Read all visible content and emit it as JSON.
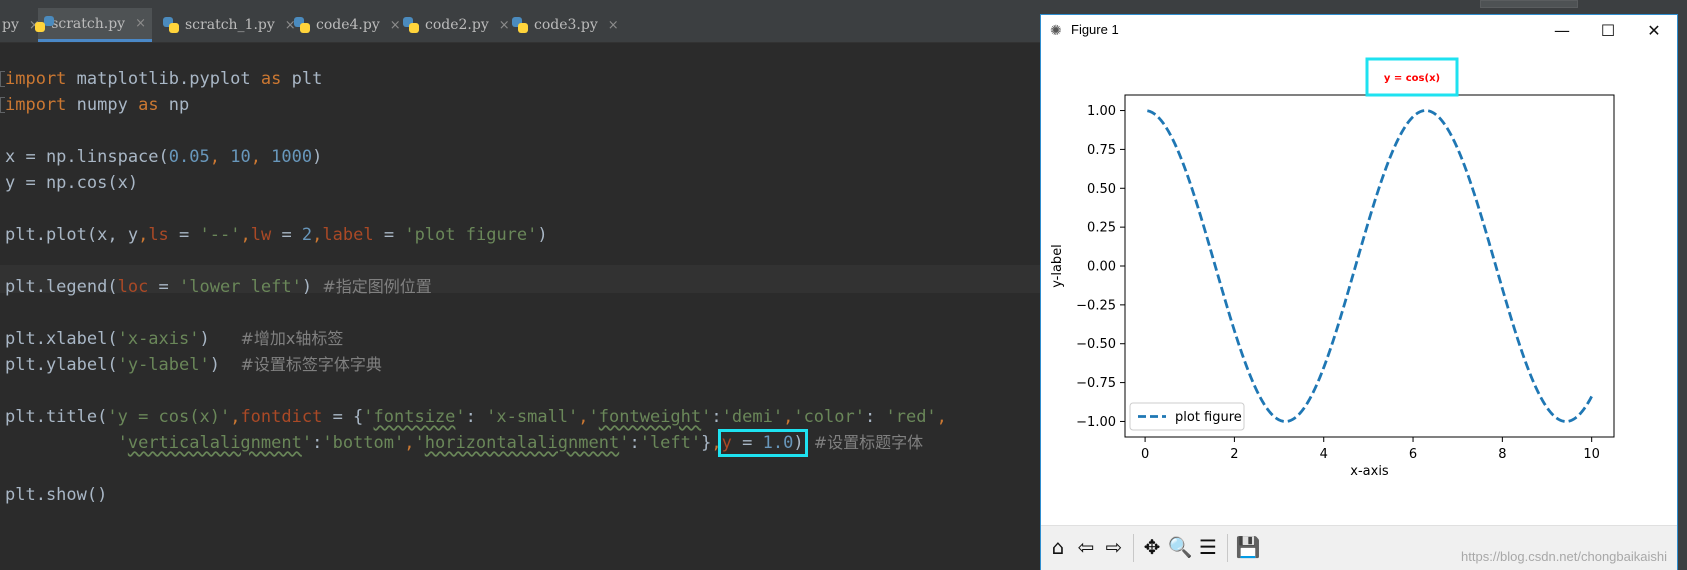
{
  "ide": {
    "tabs": [
      {
        "label": "py",
        "active": false
      },
      {
        "label": "scratch.py",
        "active": true
      },
      {
        "label": "scratch_1.py",
        "active": false
      },
      {
        "label": "code4.py",
        "active": false
      },
      {
        "label": "code2.py",
        "active": false
      },
      {
        "label": "code3.py",
        "active": false
      }
    ],
    "close_glyph": "×",
    "code": {
      "l1": {
        "kw1": "import",
        "mod": " matplotlib.pyplot ",
        "kw2": "as",
        "alias": " plt"
      },
      "l2": {
        "kw1": "import",
        "mod": " numpy ",
        "kw2": "as",
        "alias": " np"
      },
      "l3": {
        "a": "x = np.linspace(",
        "n1": "0.05",
        "c1": ", ",
        "n2": "10",
        "c2": ", ",
        "n3": "1000",
        "b": ")"
      },
      "l4": {
        "a": "y = np.cos(x)"
      },
      "l5": {
        "a": "plt.plot(x, y",
        "c1": ",",
        "p1": "ls",
        "e1": " = ",
        "s1": "'--'",
        "c2": ",",
        "p2": "lw",
        "e2": " = ",
        "n1": "2",
        "c3": ",",
        "p3": "label",
        "e3": " = ",
        "s2": "'plot figure'",
        "b": ")"
      },
      "l6": {
        "a": "plt.legend(",
        "p1": "loc",
        "e1": " = ",
        "s1": "'lower left'",
        "b": ") ",
        "cmt": "#指定图例位置"
      },
      "l7": {
        "a": "plt.xlabel(",
        "s1": "'x-axis'",
        "b": ")   ",
        "cmt": "#增加x轴标签"
      },
      "l8": {
        "a": "plt.ylabel(",
        "s1": "'y-label'",
        "b": ")  ",
        "cmt": "#设置标签字体字典"
      },
      "l9": {
        "a": "plt.title(",
        "s1": "'y = cos(x)'",
        "c1": ",",
        "p1": "fontdict",
        "e1": " = {",
        "k1": "fontsize",
        "q1": "'",
        "q2": "'",
        "col1": ": ",
        "s2": "'x-small'",
        "c2": ",",
        "k2": "fontweight",
        "col2": ":",
        "s3": "'demi'",
        "c3": ",",
        "k3": "color",
        "col3": ": ",
        "s4": "'red'",
        "c4": ","
      },
      "l10": {
        "pad": "           ",
        "k4": "verticalalignment",
        "col4": ":",
        "s5": "'bottom'",
        "c5": ",",
        "k5": "horizontalalignment",
        "col5": ":",
        "s6": "'left'",
        "b": "}",
        "c6": ",",
        "p2": "y",
        "e2": " = ",
        "n1": "1.0",
        "b2": ")",
        "cmt": "  #设置标题字体"
      },
      "l11": {
        "a": "plt.show()"
      }
    }
  },
  "figure": {
    "window_title": "Figure 1",
    "win_buttons": {
      "minimize": "—",
      "maximize": "☐",
      "close": "✕"
    },
    "toolbar": {
      "home": "⌂",
      "back": "⇦",
      "forward": "⇨",
      "pan": "✥",
      "zoom": "🔍",
      "config": "☰",
      "save": "💾"
    },
    "watermark": "https://blog.csdn.net/chongbaikaishi",
    "colors": {
      "line": "#1f77b4",
      "title": "#ff0000",
      "highlight": "#1ee2f0"
    }
  },
  "chart_data": {
    "type": "line",
    "title": "y = cos(x)",
    "xlabel": "x-axis",
    "ylabel": "y-label",
    "xlim": [
      -0.45,
      10.5
    ],
    "ylim": [
      -1.1,
      1.1
    ],
    "xticks": [
      0,
      2,
      4,
      6,
      8,
      10
    ],
    "xtick_labels": [
      "0",
      "2",
      "4",
      "6",
      "8",
      "10"
    ],
    "yticks": [
      1.0,
      0.75,
      0.5,
      0.25,
      0.0,
      -0.25,
      -0.5,
      -0.75,
      -1.0
    ],
    "ytick_labels": [
      "1.00",
      "0.75",
      "0.50",
      "0.25",
      "0.00",
      "−0.25",
      "−0.50",
      "−0.75",
      "−1.00"
    ],
    "series": [
      {
        "name": "plot figure",
        "function": "cos(x)",
        "x_start": 0.05,
        "x_end": 10,
        "num_points": 1000,
        "linestyle": "--",
        "linewidth": 2,
        "color": "#1f77b4"
      }
    ],
    "legend_position": "lower left",
    "grid": false
  }
}
